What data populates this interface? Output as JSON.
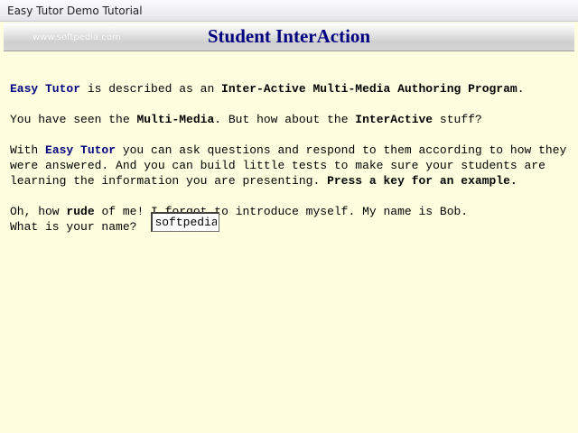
{
  "window": {
    "title": "Easy Tutor Demo Tutorial"
  },
  "header": {
    "watermark": "www.softpedia.com",
    "title": "Student InterAction"
  },
  "content": {
    "p1": {
      "brand": "Easy Tutor",
      "text1": " is described as an ",
      "bold1": "Inter-Active Multi-Media Authoring Program",
      "text2": "."
    },
    "p2": {
      "text1": "You have seen the ",
      "bold1": "Multi-Media",
      "text2": ". But how about the ",
      "bold2": "InterActive",
      "text3": " stuff?"
    },
    "p3": {
      "text1": "With ",
      "brand": "Easy Tutor",
      "text2": " you can ask questions and respond to them according to how they were answered. And you can build little tests to make sure your students are learning the information you are presenting. ",
      "bold1": "Press a key for an example."
    },
    "p4": {
      "text1": "Oh, how ",
      "bold1": "rude",
      "text2": " of me! I forgot to introduce myself. My name is Bob."
    },
    "prompt": "What is your name?",
    "name_value": "softpedia"
  },
  "colors": {
    "background": "#ffffe0",
    "heading": "#000080",
    "brand": "#000080"
  }
}
